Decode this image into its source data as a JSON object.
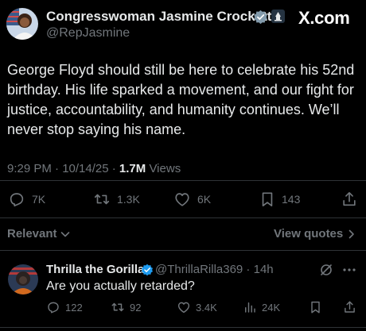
{
  "tweet": {
    "author_name": "Congresswoman Jasmine Crockett",
    "author_handle": "@RepJasmine",
    "watermark": "X.com",
    "text": "George Floyd should still be here to celebrate his 52nd birthday. His life sparked a movement, and our fight for justice, accountability, and humanity continues. We’ll never stop saying his name.",
    "time": "9:29 PM · 10/14/25 · ",
    "views_count": "1.7M",
    "views_label": " Views",
    "replies": "7K",
    "reposts": "1.3K",
    "likes": "6K",
    "bookmarks": "143"
  },
  "sort": {
    "label": "Relevant",
    "view_quotes": "View quotes"
  },
  "reply": {
    "author_name": "Thrilla the Gorilla",
    "author_handle": "@ThrillaRilla369 · 14h",
    "text": "Are you actually retarded?",
    "replies": "122",
    "reposts": "92",
    "likes": "3.4K",
    "views": "24K"
  },
  "colors": {
    "background": "#000000",
    "text": "#e7e9ea",
    "muted": "#71767b",
    "verified_blue": "#1d9bf0",
    "gov_gray": "#829aab"
  }
}
